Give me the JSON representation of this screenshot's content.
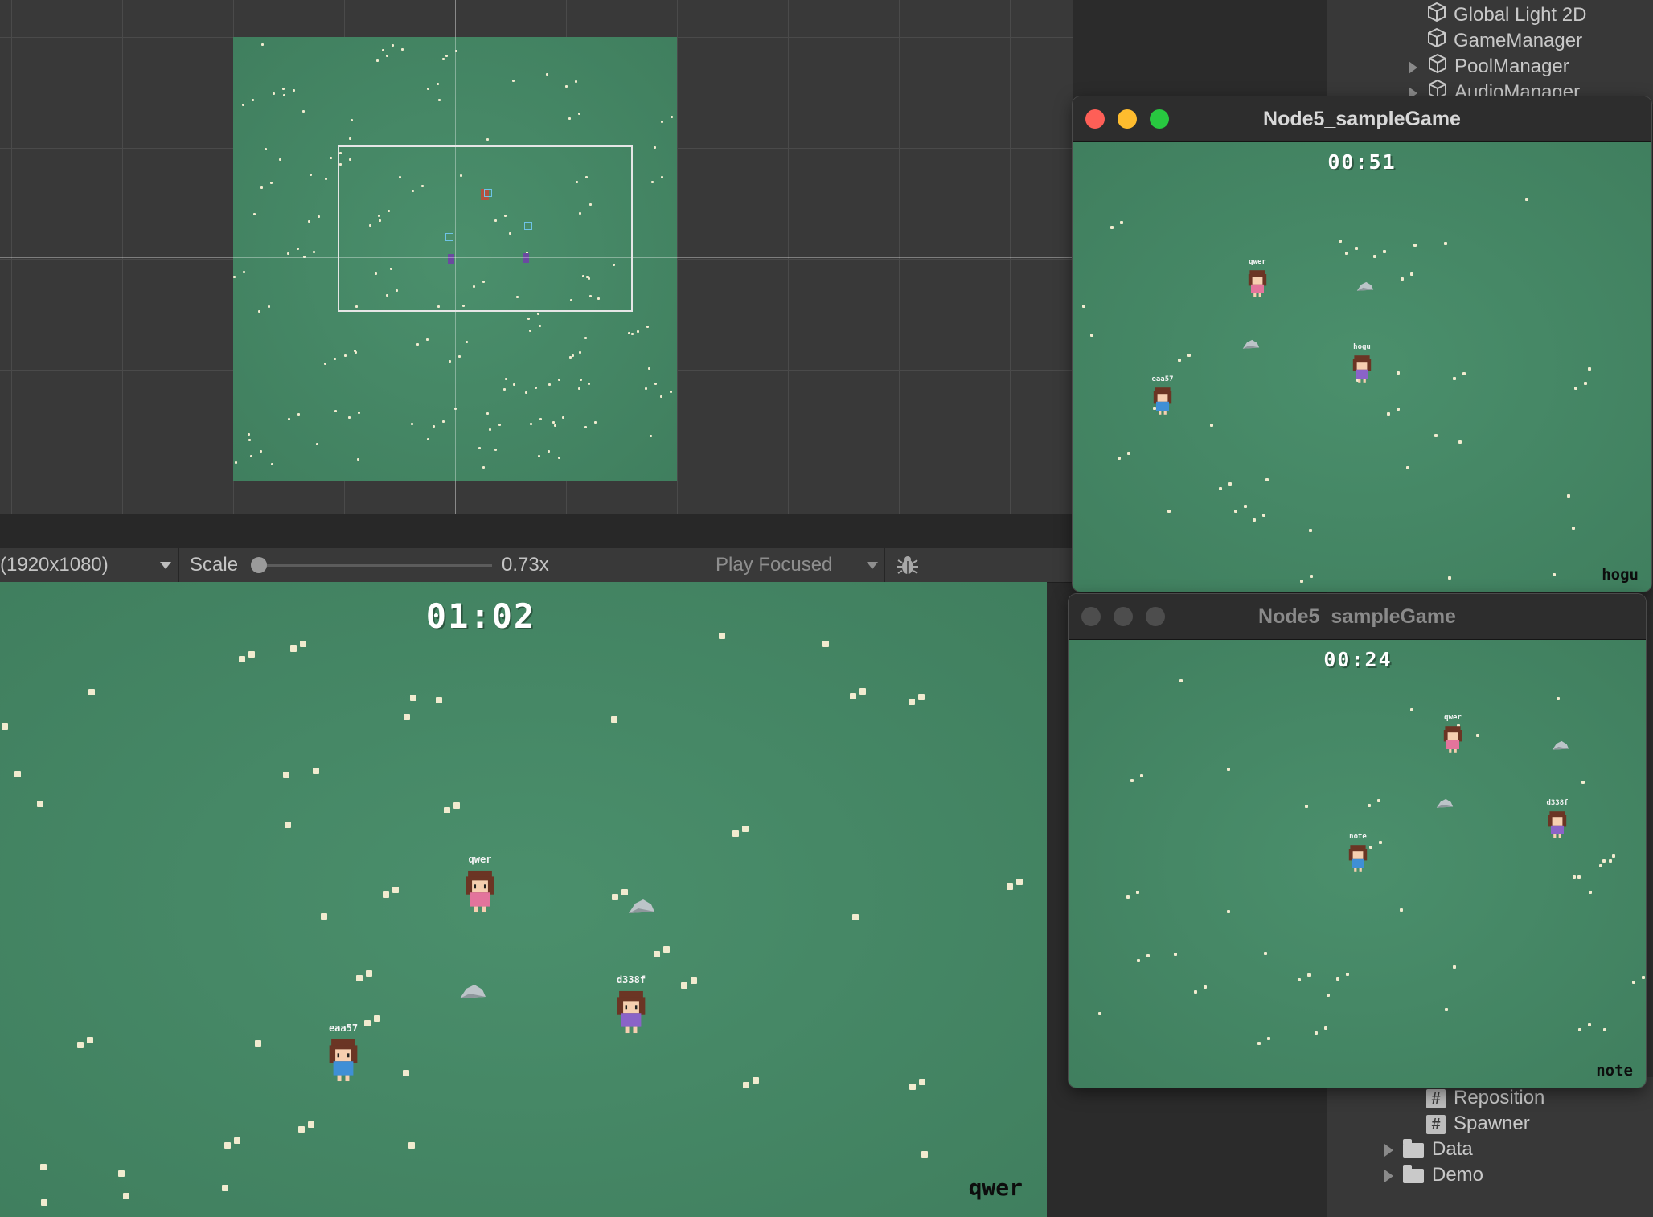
{
  "hierarchy": {
    "items": [
      {
        "label": "Global Light 2D",
        "icon": "cube-icon",
        "expandable": false
      },
      {
        "label": "GameManager",
        "icon": "cube-icon",
        "expandable": false
      },
      {
        "label": "PoolManager",
        "icon": "cube-icon",
        "expandable": true
      },
      {
        "label": "AudioManager",
        "icon": "cube-icon",
        "expandable": true
      }
    ]
  },
  "project": {
    "scripts": [
      "Reposition",
      "Spawner"
    ],
    "folders": [
      "Data",
      "Demo"
    ]
  },
  "toolbar": {
    "resolution": "(1920x1080)",
    "scale_label": "Scale",
    "scale_value": "0.73x",
    "play_mode": "Play Focused",
    "debug_icon": "bug-icon"
  },
  "game": {
    "timer": "01:02",
    "player": "qwer",
    "characters": [
      {
        "name": "qwer",
        "outfit": "pink"
      },
      {
        "name": "d338f",
        "outfit": "purple"
      },
      {
        "name": "eaa57",
        "outfit": "blue"
      }
    ]
  },
  "window1": {
    "title": "Node5_sampleGame",
    "active": true,
    "timer": "00:51",
    "player": "hogu",
    "characters": [
      {
        "name": "qwer",
        "outfit": "pink"
      },
      {
        "name": "hogu",
        "outfit": "purple"
      },
      {
        "name": "eaa57",
        "outfit": "blue"
      }
    ]
  },
  "window2": {
    "title": "Node5_sampleGame",
    "active": false,
    "timer": "00:24",
    "player": "note",
    "characters": [
      {
        "name": "qwer",
        "outfit": "pink"
      },
      {
        "name": "d338f",
        "outfit": "purple"
      },
      {
        "name": "note",
        "outfit": "blue"
      }
    ]
  },
  "colors": {
    "grass": "#478d69",
    "editor_bg": "#393939",
    "close": "#fe5f57",
    "minimize": "#febc2e",
    "maximize": "#28c840"
  }
}
